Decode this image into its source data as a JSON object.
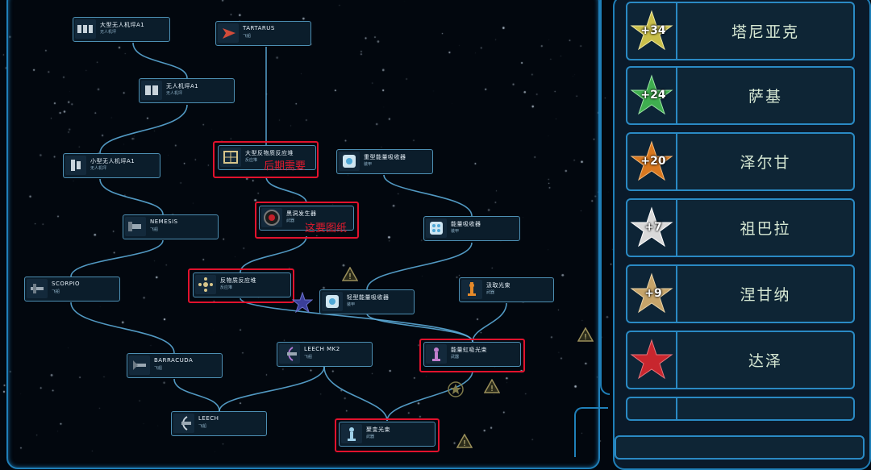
{
  "tech_tree": {
    "nodes": [
      {
        "id": "large-drone-bay",
        "title": "大型无人机坪A1",
        "sub": "无人机坪",
        "icon": "drone-bay-icon"
      },
      {
        "id": "tartarus",
        "title": "TARTARUS",
        "sub": "飞船",
        "icon": "ship-icon"
      },
      {
        "id": "drone-bay",
        "title": "无人机坪A1",
        "sub": "无人机坪",
        "icon": "drone-bay-icon"
      },
      {
        "id": "small-drone-bay",
        "title": "小型无人机坪A1",
        "sub": "无人机坪",
        "icon": "drone-bay-icon"
      },
      {
        "id": "large-antimatter-reactor",
        "title": "大型反物质反应堆",
        "sub": "反应堆",
        "icon": "reactor-icon"
      },
      {
        "id": "heavy-energy-absorber",
        "title": "重型能量吸收器",
        "sub": "装甲",
        "icon": "absorber-icon"
      },
      {
        "id": "nemesis",
        "title": "NEMESIS",
        "sub": "飞船",
        "icon": "ship-icon"
      },
      {
        "id": "black-hole-generator",
        "title": "黑洞发生器",
        "sub": "武器",
        "icon": "black-hole-icon"
      },
      {
        "id": "energy-absorber",
        "title": "能量吸收器",
        "sub": "装甲",
        "icon": "absorber-icon"
      },
      {
        "id": "scorpio",
        "title": "SCORPIO",
        "sub": "飞船",
        "icon": "ship-icon"
      },
      {
        "id": "antimatter-reactor",
        "title": "反物质反应堆",
        "sub": "反应堆",
        "icon": "reactor-icon"
      },
      {
        "id": "light-energy-absorber",
        "title": "轻型能量吸收器",
        "sub": "装甲",
        "icon": "absorber-icon"
      },
      {
        "id": "extraction-beam",
        "title": "汲取光束",
        "sub": "武器",
        "icon": "beam-icon"
      },
      {
        "id": "barracuda",
        "title": "BARRACUDA",
        "sub": "飞船",
        "icon": "ship-icon"
      },
      {
        "id": "leech-mk2",
        "title": "LEECH MK2",
        "sub": "飞船",
        "icon": "ship-icon"
      },
      {
        "id": "energy-siphon-beam",
        "title": "能量虹吸光束",
        "sub": "武器",
        "icon": "beam-icon"
      },
      {
        "id": "leech",
        "title": "LEECH",
        "sub": "飞船",
        "icon": "ship-icon"
      },
      {
        "id": "fusion-beam",
        "title": "聚变光束",
        "sub": "武器",
        "icon": "beam-icon"
      }
    ],
    "annotations": [
      {
        "text": "后期需要"
      },
      {
        "text": "这要图纸"
      }
    ]
  },
  "factions": [
    {
      "bonus": "+34",
      "name": "塔尼亚克",
      "star_color": "#c9bf4a"
    },
    {
      "bonus": "+24",
      "name": "萨基",
      "star_color": "#3fae4f"
    },
    {
      "bonus": "+20",
      "name": "泽尔甘",
      "star_color": "#d9781f"
    },
    {
      "bonus": "+7",
      "name": "祖巴拉",
      "star_color": "#d9d9d9"
    },
    {
      "bonus": "+9",
      "name": "涅甘纳",
      "star_color": "#c6a46a"
    },
    {
      "bonus": "",
      "name": "达泽",
      "star_color": "#c8262e"
    }
  ]
}
